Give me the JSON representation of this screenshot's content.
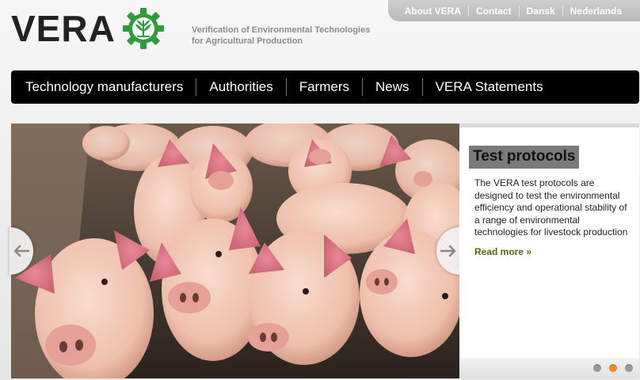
{
  "brand": {
    "logo_text": "VERA",
    "tagline_line1": "Verification of Environmental Technologies",
    "tagline_line2": "for Agricultural Production",
    "accent_green": "#2f9a3e",
    "gear_icon": "gear-wheat-icon"
  },
  "top_nav": {
    "items": [
      {
        "label": "About VERA"
      },
      {
        "label": "Contact"
      },
      {
        "label": "Dansk"
      },
      {
        "label": "Nederlands"
      }
    ]
  },
  "main_nav": {
    "items": [
      {
        "label": "Technology manufacturers"
      },
      {
        "label": "Authorities"
      },
      {
        "label": "Farmers"
      },
      {
        "label": "News"
      },
      {
        "label": "VERA Statements"
      }
    ]
  },
  "slider": {
    "image": "pigs-photo",
    "prev_icon": "arrow-left-icon",
    "next_icon": "arrow-right-icon"
  },
  "panel": {
    "title": "Test protocols",
    "body": "The VERA test protocols are designed to test the environmental efficiency and operational stability of a range of environmental technologies for livestock production",
    "read_more": "Read more »",
    "read_more_color": "#4f6b12",
    "dots": [
      {
        "active": false
      },
      {
        "active": true
      },
      {
        "active": false
      }
    ],
    "active_dot_color": "#ef8b2f"
  }
}
